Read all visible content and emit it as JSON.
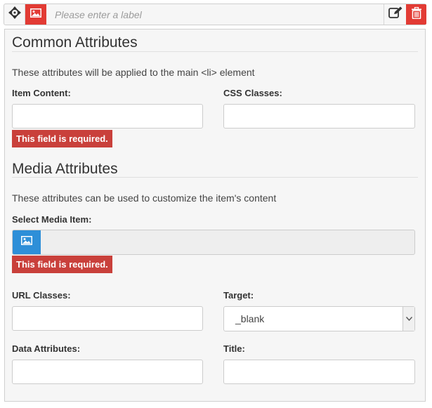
{
  "header": {
    "move_icon": "move-icon",
    "image_icon": "image-icon",
    "label_placeholder": "Please enter a label",
    "edit_icon": "edit-icon",
    "trash_icon": "trash-icon",
    "accent_color": "#e23b34"
  },
  "common": {
    "title": "Common Attributes",
    "description": "These attributes will be applied to the main <li> element",
    "item_content_label": "Item Content:",
    "item_content_value": "",
    "item_content_error": "This field is required.",
    "css_classes_label": "CSS Classes:",
    "css_classes_value": ""
  },
  "media": {
    "title": "Media Attributes",
    "description": "These attributes can be used to customize the item's content",
    "select_media_label": "Select Media Item:",
    "select_media_error": "This field is required.",
    "url_classes_label": "URL Classes:",
    "url_classes_value": "",
    "target_label": "Target:",
    "target_value": "_blank",
    "data_attributes_label": "Data Attributes:",
    "data_attributes_value": "",
    "title_label": "Title:",
    "title_value": "",
    "media_button_color": "#2e8fd8",
    "error_color": "#c9403b"
  }
}
